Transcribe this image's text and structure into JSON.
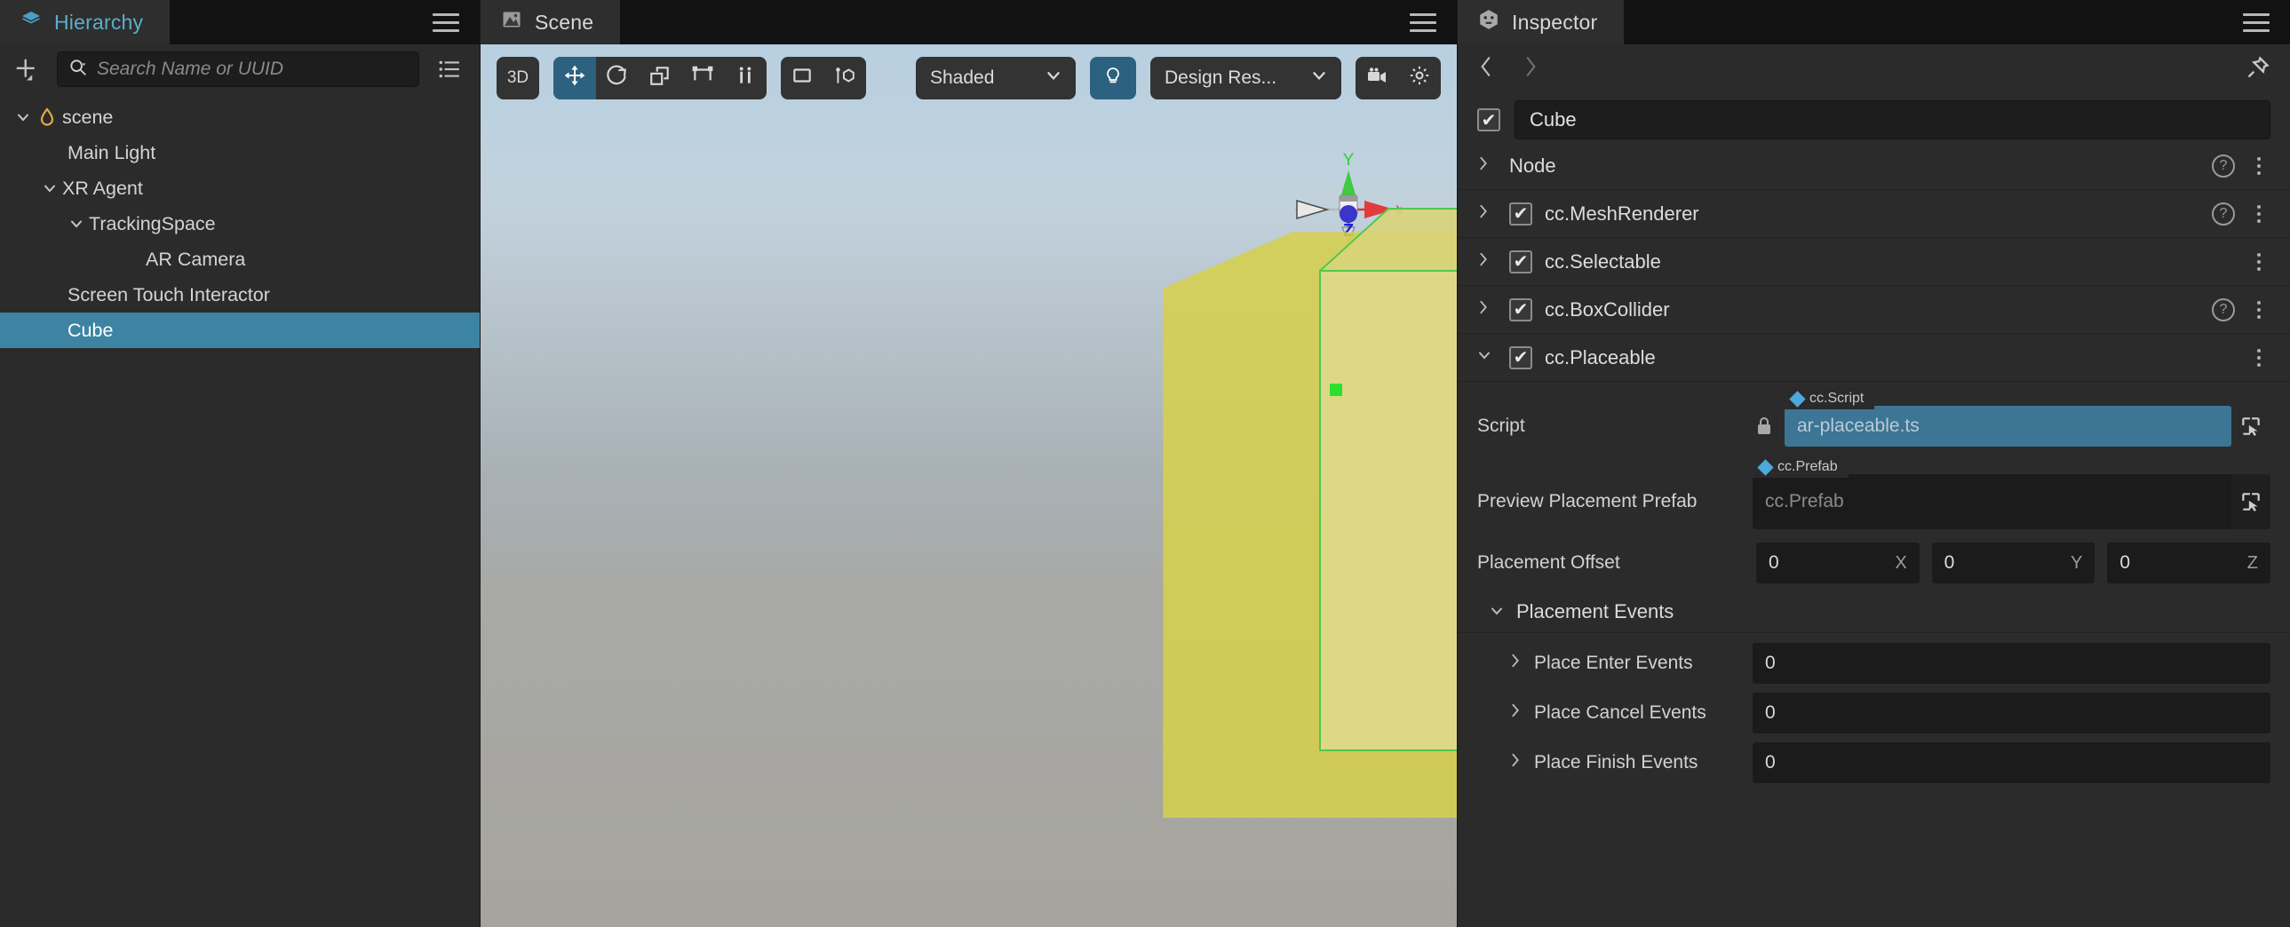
{
  "hierarchy": {
    "tab_label": "Hierarchy",
    "tab_icon": "layers-icon",
    "add_icon": "add-node-icon",
    "filter_icon": "filter-list-icon",
    "search": {
      "placeholder": "Search Name or UUID",
      "value": "",
      "icon": "search-icon"
    },
    "menu_icon": "hamburger-menu-icon",
    "nodes": [
      {
        "label": "scene",
        "depth": 0,
        "twisty": "down",
        "icon": "scene-drop-icon",
        "selected": false
      },
      {
        "label": "Main Light",
        "depth": 1,
        "twisty": "none",
        "icon": "",
        "selected": false
      },
      {
        "label": "XR Agent",
        "depth": 1,
        "twisty": "down",
        "icon": "",
        "selected": false
      },
      {
        "label": "TrackingSpace",
        "depth": 2,
        "twisty": "down",
        "icon": "",
        "selected": false
      },
      {
        "label": "AR Camera",
        "depth": 3,
        "twisty": "none",
        "icon": "",
        "selected": false
      },
      {
        "label": "Screen Touch Interactor",
        "depth": 1,
        "twisty": "none",
        "icon": "",
        "selected": false
      },
      {
        "label": "Cube",
        "depth": 1,
        "twisty": "none",
        "icon": "",
        "selected": true
      }
    ]
  },
  "scene": {
    "tab_label": "Scene",
    "tab_icon": "image-icon",
    "menu_icon": "hamburger-menu-icon",
    "toolbar": {
      "dimension_label": "3D",
      "tools": [
        {
          "name": "move-tool",
          "icon": "move-arrows-icon",
          "active": true
        },
        {
          "name": "rotate-tool",
          "icon": "rotate-icon",
          "active": false
        },
        {
          "name": "scale-tool",
          "icon": "scale-icon",
          "active": false
        },
        {
          "name": "rect-tool",
          "icon": "rect-transform-icon",
          "active": false
        },
        {
          "name": "pivot-tool",
          "icon": "pivot-icon",
          "active": false
        }
      ],
      "coord_tools": [
        {
          "name": "local-space-toggle",
          "icon": "rect-space-icon"
        },
        {
          "name": "pivot-center-toggle",
          "icon": "pivot-center-icon"
        }
      ],
      "shading_mode": "Shaded",
      "lighting_icon": "light-bulb-icon",
      "lighting_active": true,
      "resolution_mode": "Design Res...",
      "camera_icon": "camera-icon",
      "gear_icon": "gear-icon"
    },
    "gizmo": {
      "axis_x": "x",
      "axis_y": "Y",
      "axis_z": "Z"
    }
  },
  "inspector": {
    "tab_label": "Inspector",
    "tab_icon": "inspector-cube-icon",
    "menu_icon": "hamburger-menu-icon",
    "nav": {
      "back_icon": "chevron-left-icon",
      "forward_icon": "chevron-right-icon",
      "pin_icon": "pin-icon"
    },
    "node_name": "Cube",
    "node_enabled": true,
    "components": [
      {
        "label": "Node",
        "expanded": false,
        "has_checkbox": false,
        "checked": false,
        "has_help": true
      },
      {
        "label": "cc.MeshRenderer",
        "expanded": false,
        "has_checkbox": true,
        "checked": true,
        "has_help": true
      },
      {
        "label": "cc.Selectable",
        "expanded": false,
        "has_checkbox": true,
        "checked": true,
        "has_help": false
      },
      {
        "label": "cc.BoxCollider",
        "expanded": false,
        "has_checkbox": true,
        "checked": true,
        "has_help": true
      },
      {
        "label": "cc.Placeable",
        "expanded": true,
        "has_checkbox": true,
        "checked": true,
        "has_help": false
      }
    ],
    "placeable": {
      "script": {
        "label": "Script",
        "tag": "cc.Script",
        "value": "ar-placeable.ts",
        "locked": true,
        "lock_icon": "lock-icon",
        "pick_icon": "asset-picker-icon"
      },
      "preview_prefab": {
        "label": "Preview Placement Prefab",
        "tag": "cc.Prefab",
        "placeholder": "cc.Prefab",
        "value": "",
        "pick_icon": "asset-picker-icon"
      },
      "placement_offset": {
        "label": "Placement Offset",
        "axes": [
          {
            "value": "0",
            "axis": "X"
          },
          {
            "value": "0",
            "axis": "Y"
          },
          {
            "value": "0",
            "axis": "Z"
          }
        ]
      },
      "events_section": {
        "label": "Placement Events",
        "expanded": true,
        "rows": [
          {
            "label": "Place Enter Events",
            "value": "0"
          },
          {
            "label": "Place Cancel Events",
            "value": "0"
          },
          {
            "label": "Place Finish Events",
            "value": "0"
          }
        ]
      }
    }
  },
  "colors": {
    "accent_blue": "#5aaecb",
    "selection_blue": "#3d84a3",
    "tool_active": "#2c6280",
    "panel_bg": "#2b2b2b",
    "tabbar_bg": "#121212",
    "asset_filled": "#3d7594"
  }
}
